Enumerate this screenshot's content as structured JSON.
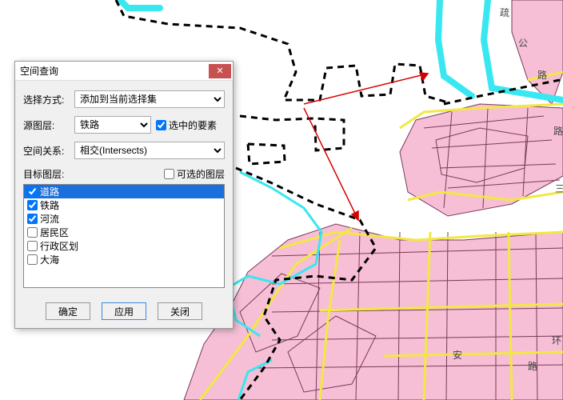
{
  "dialog": {
    "title": "空间查询",
    "select_mode_label": "选择方式:",
    "select_mode_value": "添加到当前选择集",
    "source_layer_label": "源图层:",
    "source_layer_value": "铁路",
    "selected_features_label": "选中的要素",
    "selected_features_checked": true,
    "spatial_rel_label": "空间关系:",
    "spatial_rel_value": "相交(Intersects)",
    "target_layer_label": "目标图层:",
    "selectable_layers_label": "可选的图层",
    "selectable_layers_checked": false,
    "layers": [
      {
        "label": "道路",
        "checked": true,
        "selected": true
      },
      {
        "label": "铁路",
        "checked": true,
        "selected": false
      },
      {
        "label": "河流",
        "checked": true,
        "selected": false
      },
      {
        "label": "居民区",
        "checked": false,
        "selected": false
      },
      {
        "label": "行政区划",
        "checked": false,
        "selected": false
      },
      {
        "label": "大海",
        "checked": false,
        "selected": false
      }
    ],
    "buttons": {
      "ok": "确定",
      "apply": "应用",
      "close": "关闭"
    }
  },
  "map": {
    "road_labels": [
      "疏",
      "公",
      "路",
      "路",
      "三",
      "环",
      "安",
      "路"
    ]
  }
}
